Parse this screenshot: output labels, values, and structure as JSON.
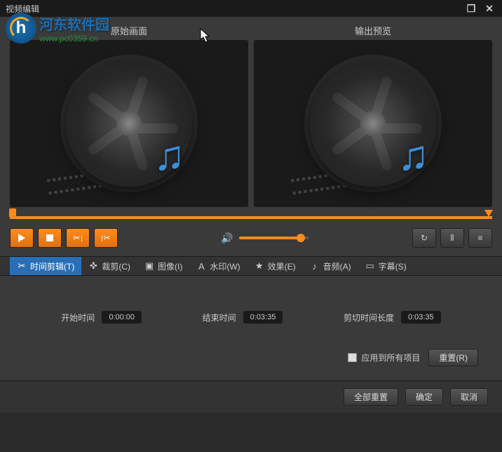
{
  "window": {
    "title": "视频编辑"
  },
  "watermark": {
    "title": "河东软件园",
    "url": "www.pc0359.cn"
  },
  "preview": {
    "original_label": "原始画面",
    "output_label": "输出预览"
  },
  "tabs": [
    {
      "label": "时间剪辑(T)"
    },
    {
      "label": "裁剪(C)"
    },
    {
      "label": "图像(I)"
    },
    {
      "label": "水印(W)"
    },
    {
      "label": "效果(E)"
    },
    {
      "label": "音频(A)"
    },
    {
      "label": "字幕(S)"
    }
  ],
  "trim": {
    "start_label": "开始时间",
    "start_value": "0:00:00",
    "end_label": "结束时间",
    "end_value": "0:03:35",
    "length_label": "剪切时间长度",
    "length_value": "0:03:35"
  },
  "apply_all_label": "应用到所有项目",
  "buttons": {
    "reset_tab": "重置(R)",
    "reset_all": "全部重置",
    "ok": "确定",
    "cancel": "取消"
  }
}
